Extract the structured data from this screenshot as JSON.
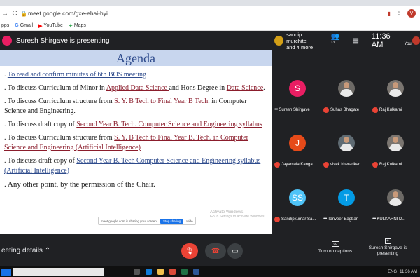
{
  "browser": {
    "url": "meet.google.com/gxe-ehai-hyi",
    "bookmarks": [
      {
        "icon": "G",
        "label": "Gmail",
        "color": "#ea4335"
      },
      {
        "icon": "▶",
        "label": "YouTube",
        "color": "#ff0000"
      },
      {
        "icon": "✦",
        "label": "Maps",
        "color": "#34a853"
      }
    ],
    "apps_label": "pps",
    "profile_initial": "V"
  },
  "meet": {
    "presenting_text": "Suresh Shirgave is presenting",
    "header_names": "sandip murchite",
    "header_more": "and 4 more",
    "participant_count": "13",
    "time": "11:36 AM",
    "you_label": "You"
  },
  "slide": {
    "title": "Agenda",
    "items": [
      {
        "prefix": "",
        "link": "To read and confirm minutes of 6th  BOS meeting",
        "mid": "",
        "link2": "",
        "suffix": ""
      },
      {
        "prefix": "To discuss Curriculum of Minor in ",
        "link": "Applied Data Science ",
        "mid": "and Hons Degree in ",
        "link2": "Data Science",
        "suffix": "."
      },
      {
        "prefix": "To discuss Curriculum structure from ",
        "link": "S. Y. B Tech to Final Year B Tech",
        "mid": ". in Computer Science and Engineering.",
        "link2": "",
        "suffix": ""
      },
      {
        "prefix": "To discuss draft copy of ",
        "link": "Second Year B. Tech. Computer Science and Engineering syllabus",
        "mid": "",
        "link2": "",
        "suffix": ""
      },
      {
        "prefix": "To discuss Curriculum structure from ",
        "link": "S. Y. B Tech to Final Year B. Tech. in Computer Science and Engineering (Artificial Intelligence)",
        "mid": "",
        "link2": "",
        "suffix": ""
      },
      {
        "prefix": "To discuss draft copy of ",
        "link": "Second Year B. Tech Computer Science and Engineering syllabus (Artificial Intelligence)",
        "mid": "",
        "link2": "",
        "suffix": ""
      },
      {
        "prefix": "Any other point, by the permission of the Chair.",
        "link": "",
        "mid": "",
        "link2": "",
        "suffix": ""
      }
    ],
    "sharing_text": "meet.google.com is sharing your screen.",
    "stop_sharing": "Stop sharing",
    "hide": "Hide",
    "watermark_title": "Activate Windows",
    "watermark_sub": "Go to Settings to activate Windows."
  },
  "participants": [
    {
      "name": "Suresh Shirgave",
      "initial": "S",
      "color": "#e91e63",
      "muted": false,
      "photo": false
    },
    {
      "name": "Suhas Bhagate",
      "initial": "",
      "color": "#6d6a66",
      "muted": true,
      "photo": true
    },
    {
      "name": "Raj Kulkarni",
      "initial": "",
      "color": "#7a7570",
      "muted": true,
      "photo": true
    },
    {
      "name": "Jayamala Kanga...",
      "initial": "J",
      "color": "#e64a19",
      "muted": true,
      "photo": false
    },
    {
      "name": "vivek kheradkar",
      "initial": "",
      "color": "#5f6b73",
      "muted": true,
      "photo": true
    },
    {
      "name": "Raj Kulkarni",
      "initial": "",
      "color": "#7a7570",
      "muted": true,
      "photo": true
    },
    {
      "name": "Sandipkumar Sa...",
      "initial": "SS",
      "color": "#4fc3f7",
      "muted": true,
      "photo": false
    },
    {
      "name": "Tanveer Bagban",
      "initial": "T",
      "color": "#039be5",
      "muted": false,
      "photo": false
    },
    {
      "name": "KULKARNI D...",
      "initial": "",
      "color": "#6d6a66",
      "muted": false,
      "photo": true
    }
  ],
  "bottom": {
    "meeting_details": "eeting details",
    "captions_label": "Turn on captions",
    "presenting_label": "Suresh Shirgave is presenting"
  },
  "taskbar": {
    "lang": "ENG",
    "time": "11:36 AM"
  }
}
